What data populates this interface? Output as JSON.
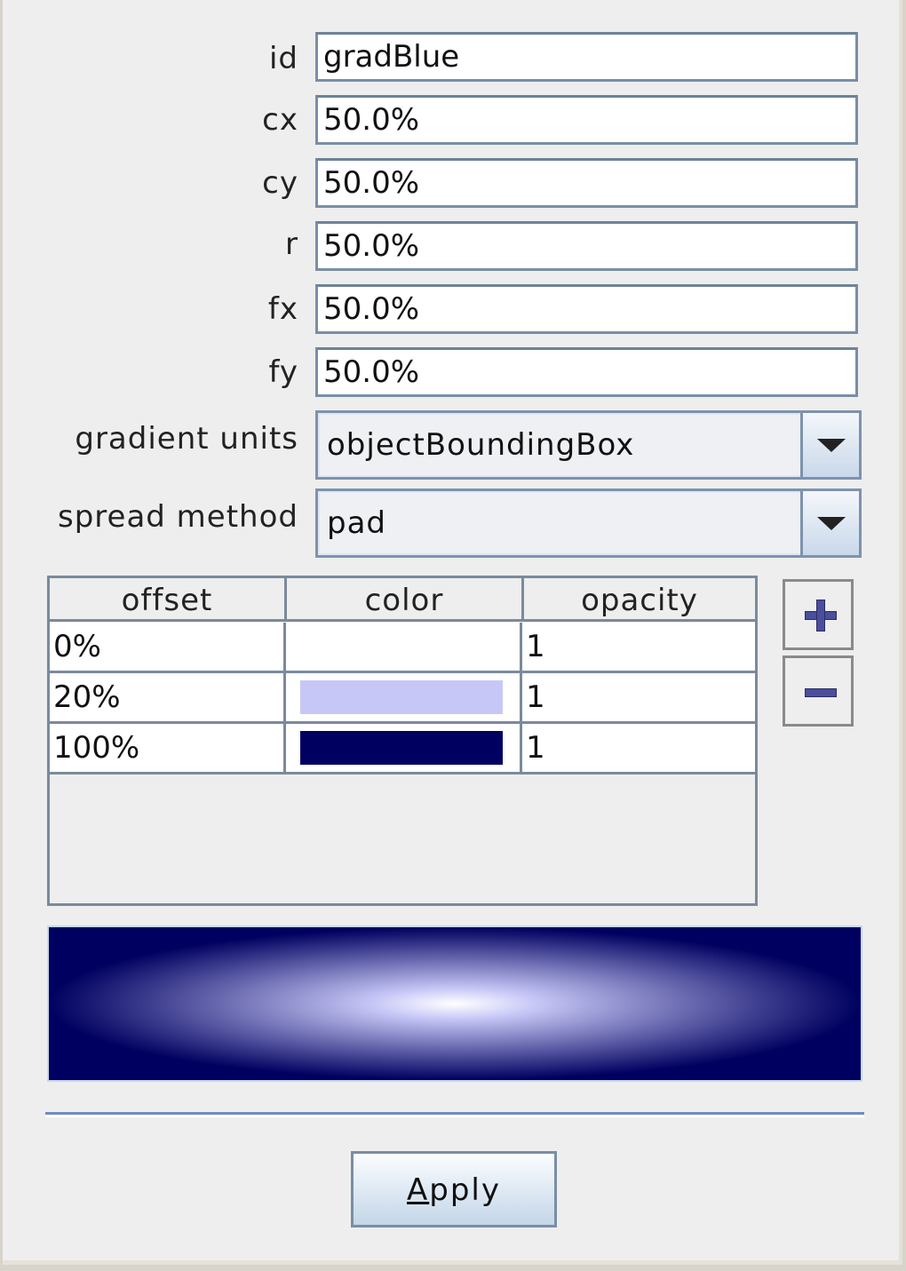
{
  "fields": [
    {
      "key": "id",
      "label": "id",
      "value": "gradBlue"
    },
    {
      "key": "cx",
      "label": "cx",
      "value": "50.0%"
    },
    {
      "key": "cy",
      "label": "cy",
      "value": "50.0%"
    },
    {
      "key": "r",
      "label": "r",
      "value": "50.0%"
    },
    {
      "key": "fx",
      "label": "fx",
      "value": "50.0%"
    },
    {
      "key": "fy",
      "label": "fy",
      "value": "50.0%"
    }
  ],
  "gradient_units": {
    "label": "gradient units",
    "value": "objectBoundingBox",
    "icon": "chevron-down-icon"
  },
  "spread_method": {
    "label": "spread method",
    "value": "pad",
    "icon": "chevron-down-icon"
  },
  "stops_table": {
    "columns": [
      "offset",
      "color",
      "opacity"
    ],
    "rows": [
      {
        "offset": "0%",
        "color": "#ffffff",
        "opacity": "1"
      },
      {
        "offset": "20%",
        "color": "#c7c7f7",
        "opacity": "1"
      },
      {
        "offset": "100%",
        "color": "#000060",
        "opacity": "1"
      }
    ]
  },
  "side_buttons": {
    "add": {
      "icon": "plus-icon"
    },
    "remove": {
      "icon": "minus-icon"
    }
  },
  "preview": {
    "type": "radial-gradient",
    "stops": [
      "0% #ffffff",
      "20% #c7c7f7",
      "100% #000060"
    ]
  },
  "apply_button": {
    "mnemonic": "A",
    "rest": "pply",
    "label": "Apply"
  }
}
